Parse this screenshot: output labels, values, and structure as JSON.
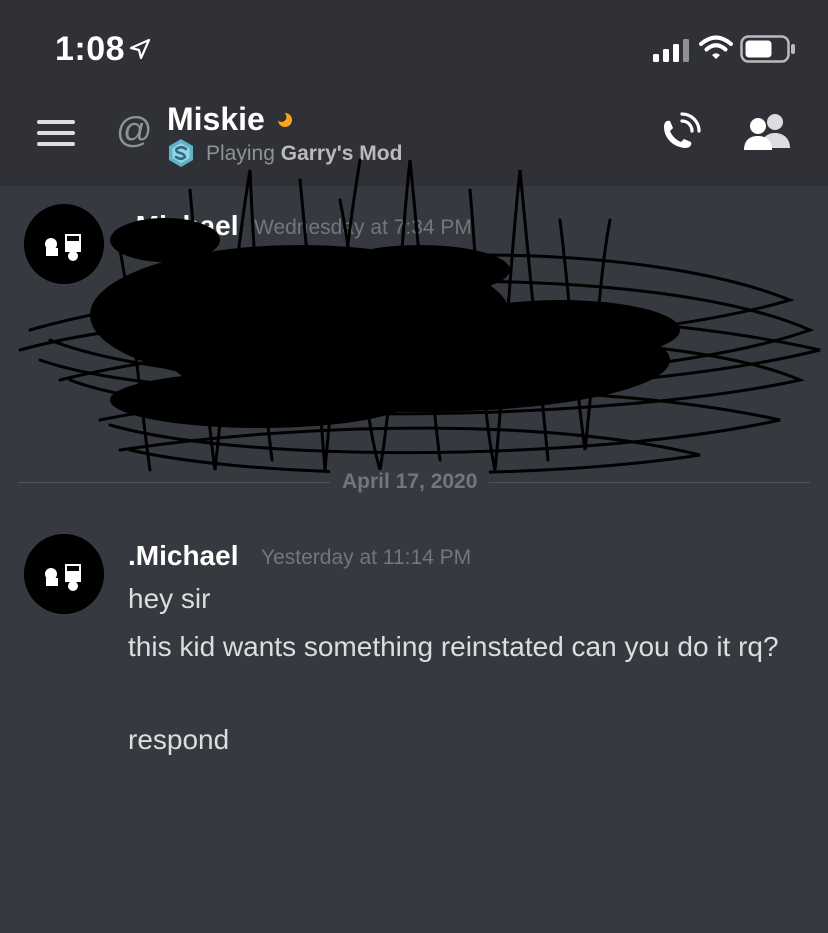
{
  "status_bar": {
    "time": "1:08",
    "icons": [
      "location-arrow-icon",
      "cellular-signal-icon",
      "wifi-icon",
      "battery-icon"
    ]
  },
  "header": {
    "menu_icon": "hamburger-menu-icon",
    "dm_icon": "@",
    "channel_name": "Miskie",
    "status": "idle",
    "presence_prefix": "Playing",
    "presence_game": "Garry's Mod",
    "actions": [
      "call-icon",
      "members-icon"
    ]
  },
  "messages": [
    {
      "author": ".Michael",
      "timestamp": "Wednesday at 7:34 PM",
      "redacted": true
    },
    {
      "author": ".Michael",
      "timestamp": "Yesterday at 11:14 PM",
      "lines": [
        "hey sir",
        "this kid wants something reinstated can you do it rq?",
        "respond"
      ]
    }
  ],
  "date_divider": "April 17, 2020",
  "colors": {
    "background": "#36393f",
    "header": "#2f3136",
    "text": "#dcddde",
    "muted": "#72767d",
    "idle": "#faa61a"
  }
}
